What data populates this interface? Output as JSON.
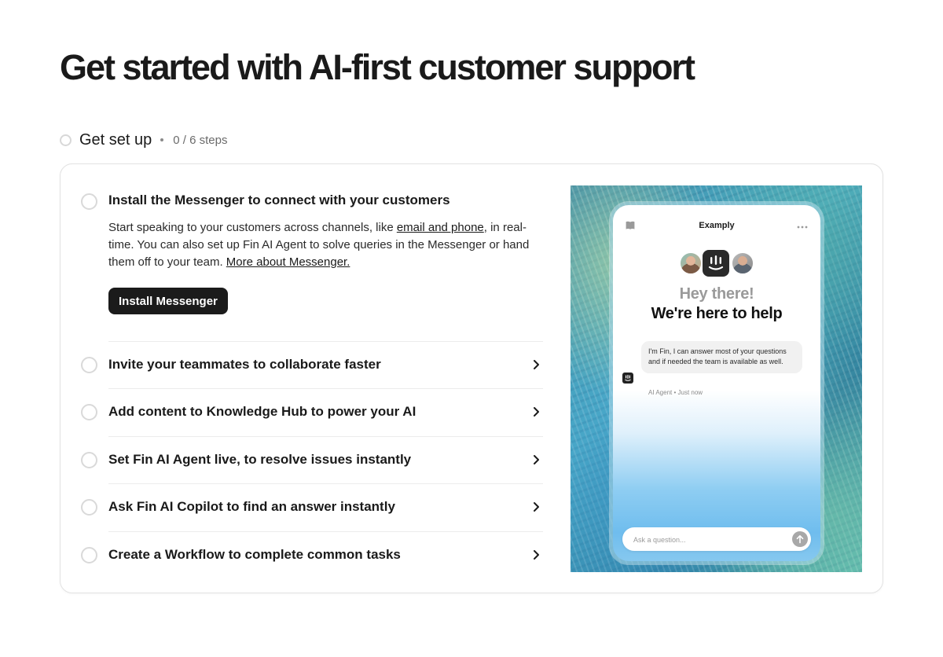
{
  "page": {
    "title": "Get started with AI-first customer support"
  },
  "setup": {
    "title": "Get set up",
    "steps_count": "0 / 6 steps"
  },
  "first_step": {
    "title": "Install the Messenger to connect with your customers",
    "desc_part1": "Start speaking to your customers across channels, like ",
    "desc_link1": "email and phone",
    "desc_part2": ", in real-time. You can also set up Fin AI Agent to solve queries in the Messenger or hand them off to your team. ",
    "desc_link2": "More about Messenger.",
    "button_label": "Install Messenger"
  },
  "steps": [
    {
      "title": "Invite your teammates to collaborate faster"
    },
    {
      "title": "Add content to Knowledge Hub to power your AI"
    },
    {
      "title": "Set Fin AI Agent live, to resolve issues instantly"
    },
    {
      "title": "Ask Fin AI Copilot to find an answer instantly"
    },
    {
      "title": "Create a Workflow to complete common tasks"
    }
  ],
  "preview": {
    "app_title": "Examply",
    "greeting": "Hey there!",
    "headline": "We're here to help",
    "message": "I'm Fin, I can answer most of your questions and if needed the team is available as well.",
    "meta": "AI Agent • Just now",
    "input_placeholder": "Ask a question..."
  },
  "icons": {
    "step_status": "empty-circle-icon",
    "chevron": "chevron-right-icon",
    "book": "book-icon",
    "more": "more-dots-icon",
    "brand": "intercom-logo-icon",
    "send": "send-arrow-icon"
  },
  "colors": {
    "primary_button": "#1b1b1b",
    "text": "#1a1a1a",
    "muted": "#6b6b6b",
    "border": "#e2e2e2"
  }
}
